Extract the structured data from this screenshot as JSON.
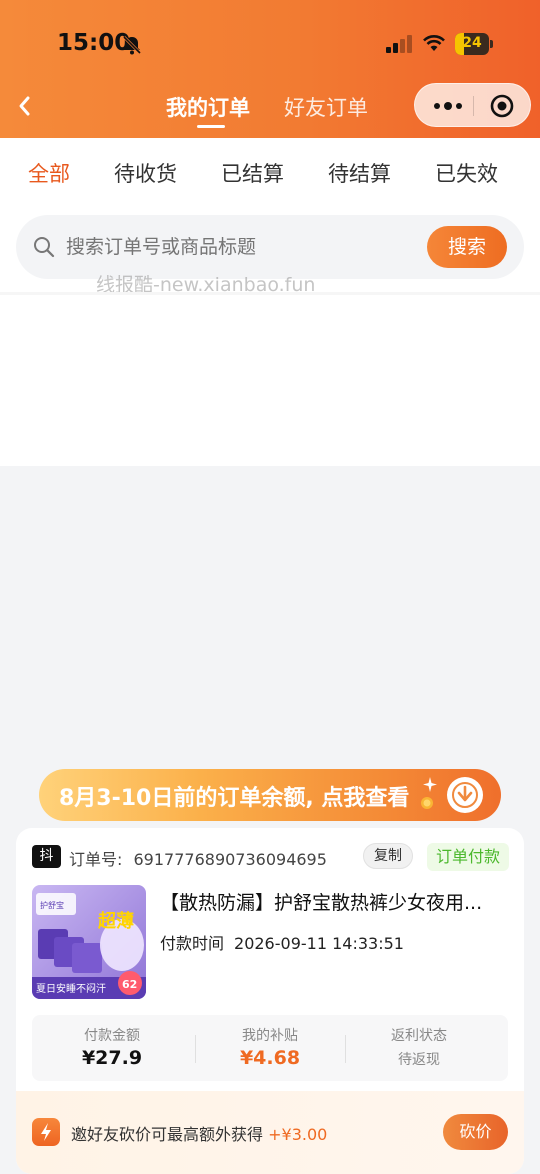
{
  "status_bar": {
    "time": "15:00",
    "battery": "24"
  },
  "header": {
    "tabs": [
      {
        "label": "我的订单",
        "active": true
      },
      {
        "label": "好友订单",
        "active": false
      }
    ]
  },
  "filter_tabs": [
    "全部",
    "待收货",
    "已结算",
    "待结算",
    "已失效"
  ],
  "search": {
    "placeholder": "搜索订单号或商品标题",
    "button": "搜索"
  },
  "watermark": "线报酷-new.xianbao.fun",
  "banner": {
    "text": "8月3-10日前的订单余额, 点我查看"
  },
  "order": {
    "platform_icon": "抖",
    "order_no_label": "订单号:",
    "order_no": "6917776890736094695",
    "copy_label": "复制",
    "status": "订单付款",
    "product_title": "【散热防漏】护舒宝散热裤少女夜用...",
    "pay_time_label": "付款时间",
    "pay_time": "2026-09-11 14:33:51",
    "image_text": {
      "brand": "护舒宝",
      "big": "超薄",
      "slogan": "夏日安睡不闷汗",
      "badge": "62"
    },
    "stats": [
      {
        "label": "付款金额",
        "value": "¥27.9"
      },
      {
        "label": "我的补贴",
        "value": "¥4.68"
      },
      {
        "label": "返利状态",
        "value": "待返现"
      }
    ],
    "invite": {
      "text": "邀好友砍价可最高额外获得",
      "amount": "+¥3.00",
      "button": "砍价"
    }
  },
  "colors": {
    "brand_orange": "#f27b32",
    "accent": "#e8591e",
    "success_green": "#4cb82d"
  }
}
